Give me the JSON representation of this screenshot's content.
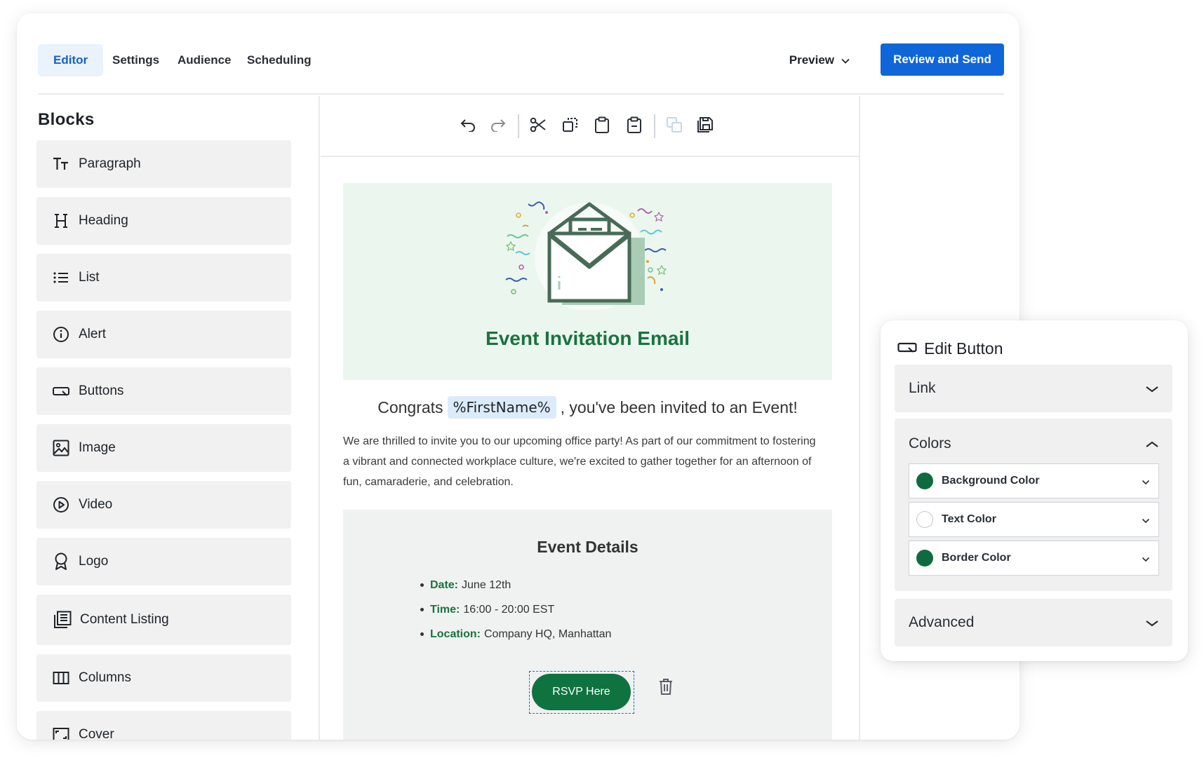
{
  "nav": {
    "tabs": [
      {
        "label": "Editor",
        "active": true
      },
      {
        "label": "Settings"
      },
      {
        "label": "Audience"
      },
      {
        "label": "Scheduling"
      }
    ],
    "preview_label": "Preview",
    "review_label": "Review and Send"
  },
  "sidebar": {
    "title": "Blocks",
    "items": [
      {
        "label": "Paragraph",
        "icon": "paragraph-icon"
      },
      {
        "label": "Heading",
        "icon": "heading-icon"
      },
      {
        "label": "List",
        "icon": "list-icon"
      },
      {
        "label": "Alert",
        "icon": "alert-icon"
      },
      {
        "label": "Buttons",
        "icon": "button-icon"
      },
      {
        "label": "Image",
        "icon": "image-icon"
      },
      {
        "label": "Video",
        "icon": "video-icon"
      },
      {
        "label": "Logo",
        "icon": "logo-icon"
      },
      {
        "label": "Content Listing",
        "icon": "content-listing-icon"
      },
      {
        "label": "Columns",
        "icon": "columns-icon"
      },
      {
        "label": "Cover",
        "icon": "cover-icon"
      }
    ]
  },
  "toolbar": {
    "tools": [
      "undo-icon",
      "redo-icon",
      "cut-icon",
      "copy-icon",
      "paste-icon",
      "paste-text-icon",
      "duplicate-icon",
      "save-icon"
    ]
  },
  "email": {
    "hero_title": "Event Invitation Email",
    "greeting_before": "Congrats",
    "merge_tag": "%FirstName%",
    "greeting_after": ", you've been invited to an Event!",
    "intro": "We are thrilled to invite you to our upcoming office party! As part of our commitment to fostering a vibrant and connected workplace culture, we're excited to gather together for an afternoon of fun, camaraderie, and celebration.",
    "details_title": "Event Details",
    "details": [
      {
        "label": "Date:",
        "value": "June 12th"
      },
      {
        "label": "Time:",
        "value": "16:00 - 20:00 EST"
      },
      {
        "label": "Location:",
        "value": "Company HQ, Manhattan"
      }
    ],
    "rsvp_label": "RSVP Here"
  },
  "edit_panel": {
    "title": "Edit Button",
    "sections": {
      "link": "Link",
      "colors": "Colors",
      "advanced": "Advanced"
    },
    "colors": [
      {
        "label": "Background Color",
        "value": "#0f6b3f"
      },
      {
        "label": "Text Color",
        "value": "#ffffff"
      },
      {
        "label": "Border Color",
        "value": "#0f6b3f"
      }
    ]
  },
  "theme": {
    "accent": "#0f66d9",
    "brand_green": "#1a7340",
    "hero_bg": "#ebf7ee"
  }
}
